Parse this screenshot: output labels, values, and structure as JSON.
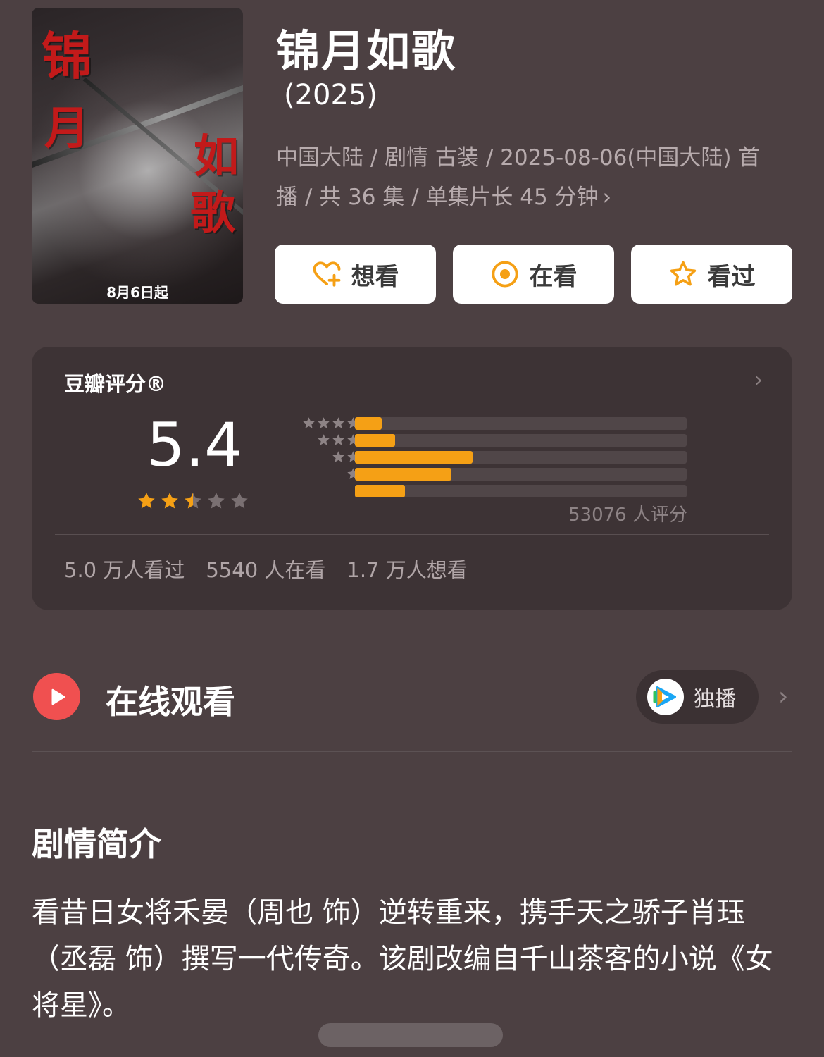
{
  "poster": {
    "calligraphy": [
      "锦",
      "月",
      "如",
      "歌"
    ],
    "date_text": "8月6日起"
  },
  "header": {
    "title": "锦月如歌",
    "year": "(2025)",
    "meta_line1": "中国大陆 / 剧情 古装 / 2025-08-06(中国大陆) 首",
    "meta_line2": "播 / 共 36 集 / 单集片长 45 分钟"
  },
  "actions": {
    "want_label": "想看",
    "watching_label": "在看",
    "watched_label": "看过"
  },
  "rating": {
    "heading": "豆瓣评分®",
    "score": "5.4",
    "stars_filled": 2.5,
    "star_color": "#f5a015",
    "distribution": [
      {
        "stars": 5,
        "fraction": 0.08
      },
      {
        "stars": 4,
        "fraction": 0.12
      },
      {
        "stars": 3,
        "fraction": 0.355
      },
      {
        "stars": 2,
        "fraction": 0.29
      },
      {
        "stars": 1,
        "fraction": 0.15
      }
    ],
    "votes": "53076 人评分",
    "stats": [
      "5.0 万人看过",
      "5540 人在看",
      "1.7 万人想看"
    ]
  },
  "watch": {
    "title": "在线观看",
    "platform_label": "独播",
    "play_color": "#f05050"
  },
  "synopsis": {
    "title": "剧情简介",
    "body": "看昔日女将禾晏（周也 饰）逆转重来，携手天之骄子肖珏（丞磊 饰）撰写一代传奇。该剧改编自千山茶客的小说《女将星》。"
  },
  "icons": {
    "want": "heart-plus-icon",
    "watching": "target-icon",
    "watched": "star-icon",
    "play": "play-icon",
    "platform": "tencent-video-icon"
  }
}
